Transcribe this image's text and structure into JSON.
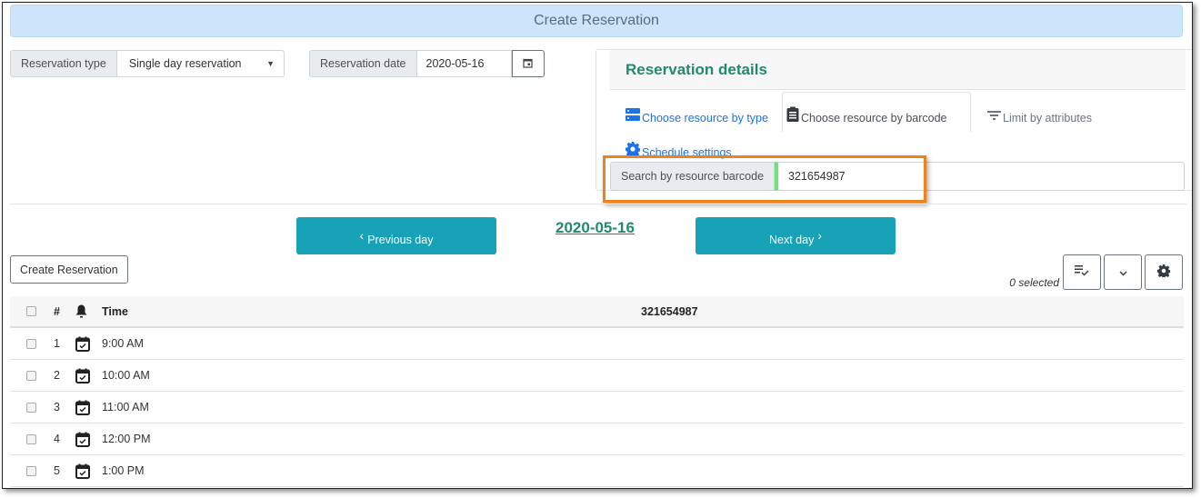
{
  "header": {
    "title": "Create Reservation"
  },
  "reservation_type": {
    "label": "Reservation type",
    "selected": "Single day reservation",
    "dropdown_glyph": "▼"
  },
  "reservation_date": {
    "label": "Reservation date",
    "value": "2020-05-16",
    "calendar_icon": "calendar-icon"
  },
  "details": {
    "title": "Reservation details",
    "tabs": [
      {
        "label": "Choose resource by type",
        "icon": "storage-icon",
        "active": false
      },
      {
        "label": "Choose resource by barcode",
        "icon": "clipboard-icon",
        "active": true
      },
      {
        "label": "Limit by attributes",
        "icon": "filter-icon",
        "active": false
      },
      {
        "label": "Schedule settings",
        "icon": "gear-icon",
        "active": false
      }
    ],
    "search": {
      "label": "Search by resource barcode",
      "value": "321654987"
    }
  },
  "navigation": {
    "previous_label": "Previous day",
    "next_label": "Next day",
    "current_date": "2020-05-16",
    "prev_glyph": "‹",
    "next_glyph": "›"
  },
  "actions": {
    "create_label": "Create Reservation",
    "selected_count": "0 selected"
  },
  "grid": {
    "headers": {
      "num": "#",
      "time": "Time",
      "resource": "321654987"
    },
    "rows": [
      {
        "num": "1",
        "time": "9:00 AM"
      },
      {
        "num": "2",
        "time": "10:00 AM"
      },
      {
        "num": "3",
        "time": "11:00 AM"
      },
      {
        "num": "4",
        "time": "12:00 PM"
      },
      {
        "num": "5",
        "time": "1:00 PM"
      }
    ]
  },
  "colors": {
    "accent_teal": "#18a2b8",
    "heading_green": "#208a6c",
    "link_blue": "#1a73e8",
    "highlight_orange": "#f0821e",
    "title_bg": "#cce5fb"
  }
}
